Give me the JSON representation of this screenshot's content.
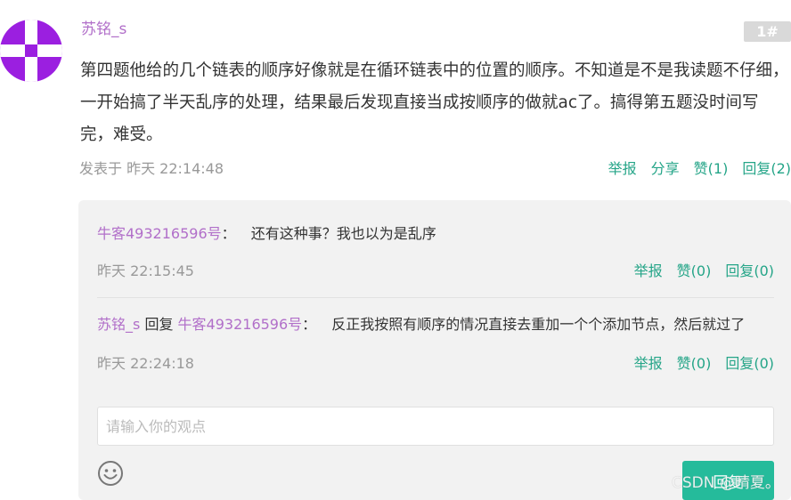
{
  "post": {
    "username": "苏铭_s",
    "floor": "1#",
    "content": "第四题他给的几个链表的顺序好像就是在循环链表中的位置的顺序。不知道是不是我读题不仔细，一开始搞了半天乱序的处理，结果最后发现直接当成按顺序的做就ac了。搞得第五题没时间写完，难受。",
    "time": "发表于 昨天 22:14:48",
    "actions": {
      "report": "举报",
      "share": "分享",
      "like": "赞(1)",
      "reply": "回复(2)"
    }
  },
  "replies": [
    {
      "user": "牛客493216596号",
      "separator": "：",
      "text": "还有这种事？我也以为是乱序",
      "time": "昨天 22:15:45",
      "report": "举报",
      "like": "赞(0)",
      "reply": "回复(0)"
    },
    {
      "user": "苏铭_s",
      "reply_word": "回复",
      "target": "牛客493216596号",
      "separator": "：",
      "text": "反正我按照有顺序的情况直接去重加一个个添加节点，然后就过了",
      "time": "昨天 22:24:18",
      "report": "举报",
      "like": "赞(0)",
      "reply": "回复(0)"
    }
  ],
  "comment_box": {
    "placeholder": "请输入你的观点",
    "submit_label": "回复"
  },
  "watermark": "CSDN @晴夏。",
  "icons": {
    "avatar": "avatar-icon",
    "emoji": "smiley-icon"
  },
  "colors": {
    "username": "#b16fc9",
    "action": "#25a588",
    "button": "#25bb9b",
    "avatar": "#9b1fe0"
  }
}
